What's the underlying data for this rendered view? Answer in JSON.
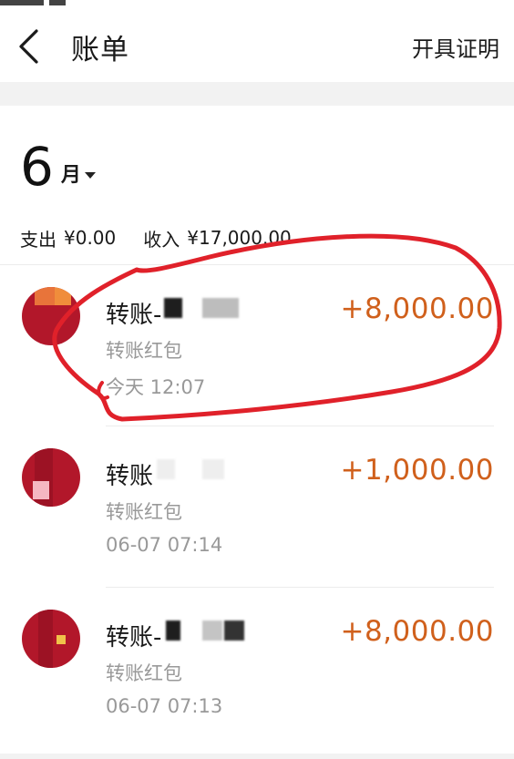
{
  "header": {
    "title": "账单",
    "action_label": "开具证明"
  },
  "summary": {
    "month": "6",
    "month_unit": "月",
    "expense_label": "支出",
    "expense_value": "¥0.00",
    "income_label": "收入",
    "income_value": "¥17,000.00"
  },
  "transactions": [
    {
      "name": "转账-",
      "type": "转账红包",
      "time": "今天  12:07",
      "amount": "+8,000.00"
    },
    {
      "name": "转账",
      "type": "转账红包",
      "time": "06-07  07:14",
      "amount": "+1,000.00"
    },
    {
      "name": "转账-",
      "type": "转账红包",
      "time": "06-07  07:13",
      "amount": "+8,000.00"
    }
  ],
  "colors": {
    "amount": "#d0601c",
    "annotation": "#e0212a",
    "avatar": "#b2172a"
  },
  "icons": {
    "back": "chevron-left-icon",
    "month_dropdown": "caret-down-icon"
  }
}
